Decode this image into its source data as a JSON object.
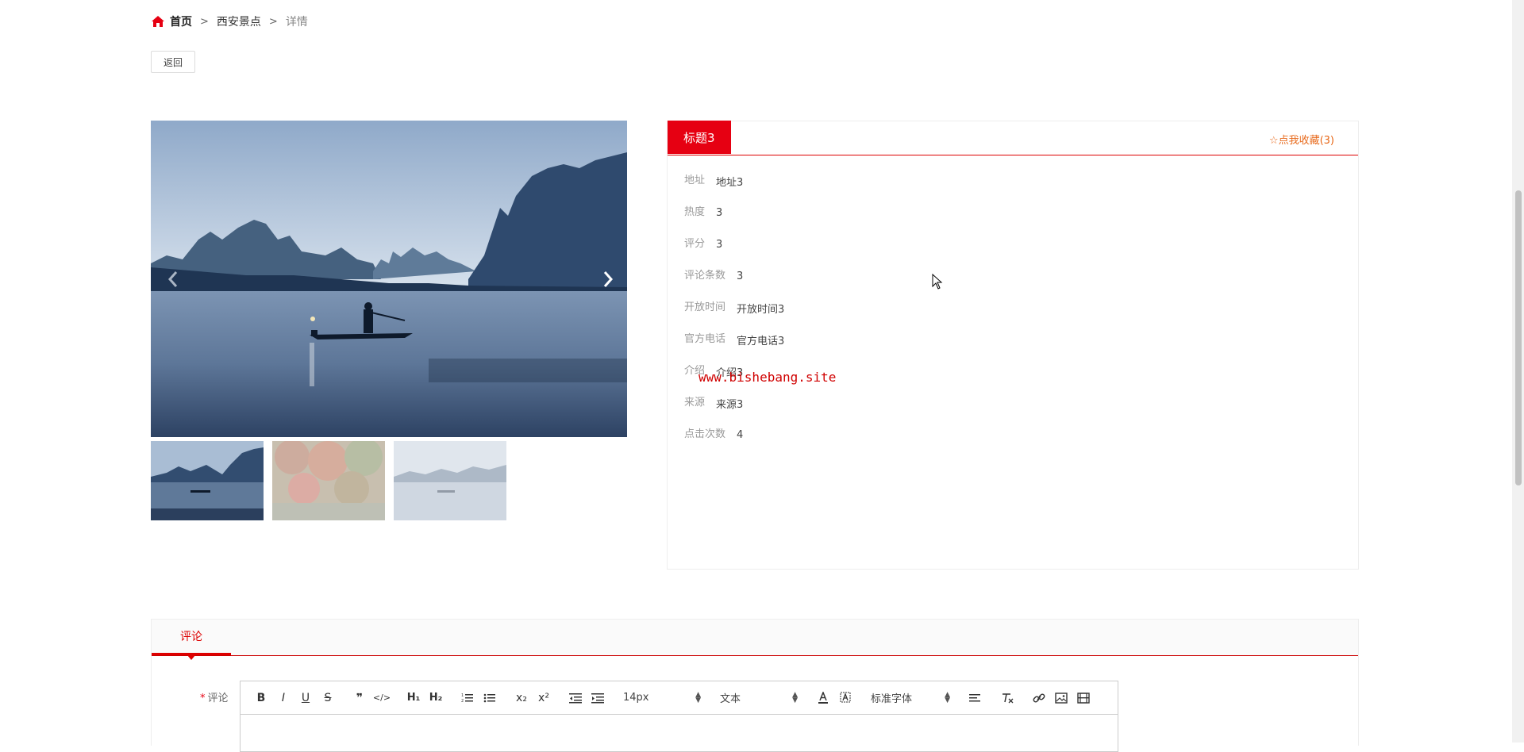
{
  "breadcrumb": {
    "home": "首页",
    "category": "西安景点",
    "current": "详情",
    "separator": ">"
  },
  "back_button": "返回",
  "detail": {
    "title_tab": "标题3",
    "favorite": "☆点我收藏(3)",
    "fields": [
      {
        "label": "地址",
        "value": "地址3"
      },
      {
        "label": "热度",
        "value": "3"
      },
      {
        "label": "评分",
        "value": "3"
      },
      {
        "label": "评论条数",
        "value": "3"
      },
      {
        "label": "开放时间",
        "value": "开放时间3"
      },
      {
        "label": "官方电话",
        "value": "官方电话3"
      },
      {
        "label": "介绍",
        "value": "介绍3"
      },
      {
        "label": "来源",
        "value": "来源3"
      },
      {
        "label": "点击次数",
        "value": "4"
      }
    ]
  },
  "watermark": "www.bishebang.site",
  "comments": {
    "tab": "评论",
    "field_label": "评论",
    "required_mark": "*",
    "toolbar": {
      "bold": "B",
      "italic": "I",
      "underline": "U",
      "strike": "S",
      "quote": "❞",
      "code": "</>",
      "h1": "H₁",
      "h2": "H₂",
      "subscript": "x₂",
      "superscript": "x²",
      "font_size": "14px",
      "text_style": "文本",
      "font_family": "标准字体"
    }
  },
  "colors": {
    "accent": "#e60012",
    "favorite": "#e86a1c"
  }
}
